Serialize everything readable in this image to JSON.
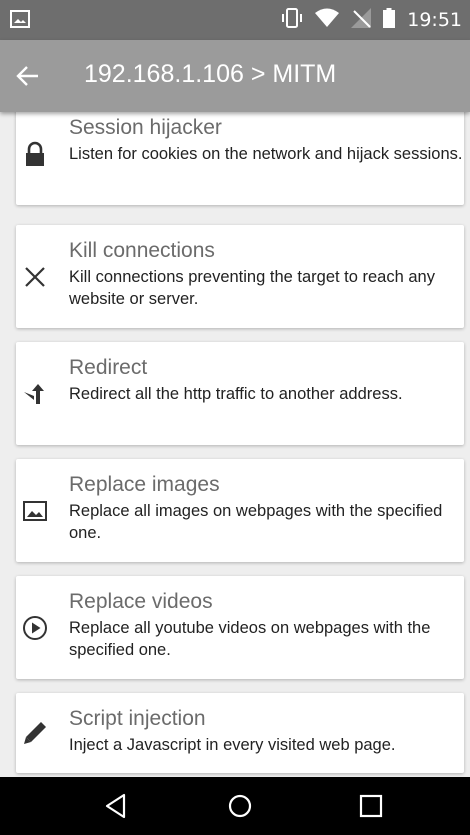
{
  "status_bar": {
    "time": "19:51",
    "icons": [
      "image-notification-icon",
      "vibrate-icon",
      "wifi-icon",
      "no-sim-icon",
      "battery-icon"
    ]
  },
  "app_bar": {
    "title": "192.168.1.106 > MITM",
    "back_icon": "arrow-back-icon"
  },
  "items": [
    {
      "title": "Session hijacker",
      "description": "Listen for cookies on the network and hijack sessions.",
      "icon": "lock-icon"
    },
    {
      "title": "Kill connections",
      "description": "Kill connections preventing the target to reach any website or server.",
      "icon": "close-icon"
    },
    {
      "title": "Redirect",
      "description": "Redirect all the http traffic to another address.",
      "icon": "redirect-arrow-icon"
    },
    {
      "title": "Replace images",
      "description": "Replace all images on webpages with the specified one.",
      "icon": "image-icon"
    },
    {
      "title": "Replace videos",
      "description": "Replace all youtube videos on webpages with the specified one.",
      "icon": "play-circle-icon"
    },
    {
      "title": "Script injection",
      "description": "Inject a Javascript in every visited web page.",
      "icon": "pencil-icon"
    }
  ],
  "nav_bar": {
    "buttons": [
      "back-triangle-icon",
      "home-circle-icon",
      "recents-square-icon"
    ]
  },
  "colors": {
    "status_bar": "#6e6e6e",
    "app_bar": "#9b9b9b",
    "background": "#eeeeee",
    "nav_bar": "#000000"
  }
}
